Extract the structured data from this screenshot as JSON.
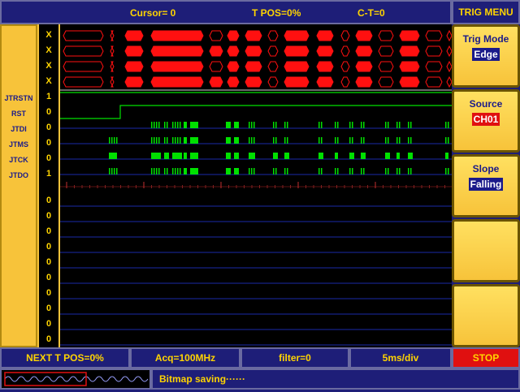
{
  "header": {
    "cursor": "Cursor= 0",
    "tpos": "T POS=0%",
    "ct": "C-T=0",
    "menu_title": "TRIG MENU"
  },
  "menu": {
    "trig_mode": {
      "label": "Trig Mode",
      "value": "Edge"
    },
    "source": {
      "label": "Source",
      "value": "CH01"
    },
    "slope": {
      "label": "Slope",
      "value": "Falling"
    }
  },
  "channels": [
    {
      "name": "",
      "level": "X"
    },
    {
      "name": "",
      "level": "X"
    },
    {
      "name": "",
      "level": "X"
    },
    {
      "name": "",
      "level": "X"
    },
    {
      "name": "JTRSTN",
      "level": "1"
    },
    {
      "name": "RST",
      "level": "0"
    },
    {
      "name": "JTDI",
      "level": "0"
    },
    {
      "name": "JTMS",
      "level": "0"
    },
    {
      "name": "JTCK",
      "level": "0"
    },
    {
      "name": "JTDO",
      "level": "1"
    }
  ],
  "extra_levels": [
    "0",
    "0",
    "0",
    "0",
    "0",
    "0",
    "0",
    "0",
    "0",
    "0"
  ],
  "footer": {
    "next_tpos": "NEXT T POS=0%",
    "acq": "Acq=100MHz",
    "filter": "filter=0",
    "timebase": "5ms/div",
    "stop": "STOP",
    "status": "Bitmap saving······"
  },
  "colors": {
    "bus_fill": "#ff1010",
    "signal": "#00e000",
    "grid": "#1a2aa8",
    "accent": "#ffd400"
  }
}
